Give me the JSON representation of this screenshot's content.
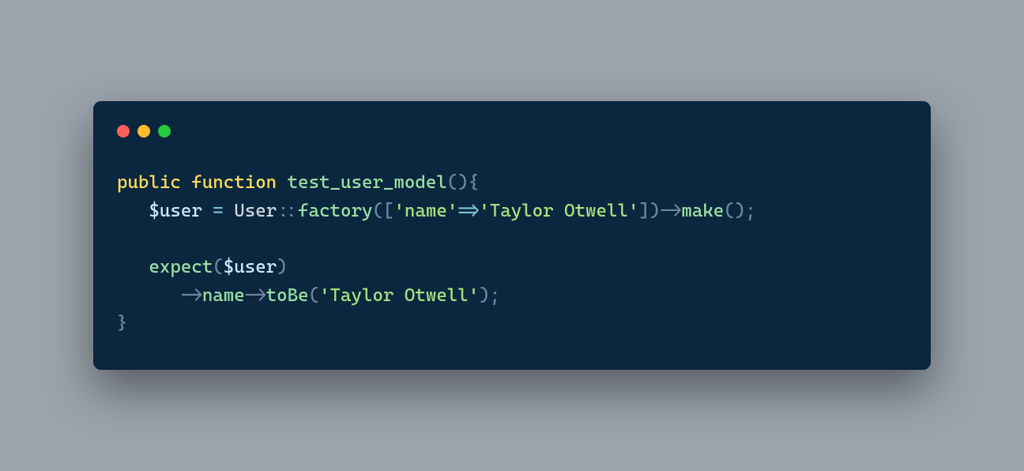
{
  "code": {
    "line1": {
      "public": "public",
      "function": "function",
      "fn": "test_user_model",
      "op1": "(",
      "op2": ")",
      "op3": "{"
    },
    "line2": {
      "indent": "   ",
      "var": "$user",
      "eq": " = ",
      "class": "User",
      "dcolon": "::",
      "factory": "factory",
      "p1": "(",
      "b1": "[",
      "q1": "'",
      "key": "name",
      "q2": "'",
      "fat": "=>",
      "q3": "'",
      "val": "Taylor Otwell",
      "q4": "'",
      "b2": "]",
      "p2": ")",
      "arr": "->",
      "make": "make",
      "p3": "(",
      "p4": ")",
      "semi": ";"
    },
    "line3": {
      "indent": "   ",
      "expect": "expect",
      "p1": "(",
      "var": "$user",
      "p2": ")"
    },
    "line4": {
      "indent": "      ",
      "arr1": "->",
      "name": "name",
      "arr2": "->",
      "tobe": "toBe",
      "p1": "(",
      "q1": "'",
      "val": "Taylor Otwell",
      "q2": "'",
      "p2": ")",
      "semi": ";"
    },
    "line5": {
      "close": "}"
    }
  }
}
